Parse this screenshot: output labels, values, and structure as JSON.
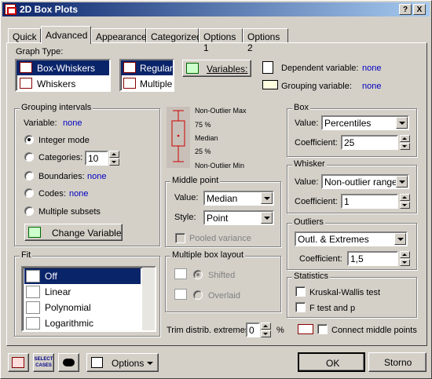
{
  "window": {
    "title": "2D Box Plots",
    "help_btn": "?",
    "close_btn": "X"
  },
  "tabs": [
    "Quick",
    "Advanced",
    "Appearance",
    "Categorized",
    "Options 1",
    "Options 2"
  ],
  "graph_type": {
    "label": "Graph Type:",
    "types_a": [
      "Box-Whiskers",
      "Whiskers"
    ],
    "types_b": [
      "Regular",
      "Multiple"
    ]
  },
  "variables": {
    "button": "Variables:",
    "dependent_label": "Dependent variable:",
    "dependent_value": "none",
    "grouping_label": "Grouping variable:",
    "grouping_value": "none"
  },
  "legend": {
    "max": "Non-Outlier Max",
    "p75": "75 %",
    "median": "Median",
    "p25": "25 %",
    "min": "Non-Outlier Min"
  },
  "grouping": {
    "title": "Grouping intervals",
    "variable_label": "Variable:",
    "variable_value": "none",
    "integer_mode": "Integer mode",
    "categories": "Categories:",
    "categories_value": "10",
    "boundaries": "Boundaries:",
    "boundaries_value": "none",
    "codes": "Codes:",
    "codes_value": "none",
    "multiple_subsets": "Multiple subsets",
    "change_variable": "Change Variable"
  },
  "box": {
    "title": "Box",
    "value_label": "Value:",
    "value": "Percentiles",
    "coef_label": "Coefficient:",
    "coef": "25"
  },
  "whisker": {
    "title": "Whisker",
    "value_label": "Value:",
    "value": "Non-outlier range",
    "coef_label": "Coefficient:",
    "coef": "1"
  },
  "outliers": {
    "title": "Outliers",
    "value": "Outl. & Extremes",
    "coef_label": "Coefficient:",
    "coef": "1,5"
  },
  "middle": {
    "title": "Middle point",
    "value_label": "Value:",
    "value": "Median",
    "style_label": "Style:",
    "style": "Point",
    "pooled": "Pooled variance"
  },
  "fit": {
    "title": "Fit",
    "items": [
      "Off",
      "Linear",
      "Polynomial",
      "Logarithmic"
    ]
  },
  "layout": {
    "title": "Multiple box layout",
    "shifted": "Shifted",
    "overlaid": "Overlaid"
  },
  "trim": {
    "label": "Trim distrib. extremes:",
    "value": "0",
    "unit": "%"
  },
  "statistics": {
    "title": "Statistics",
    "kw": "Kruskal-Wallis test",
    "ft": "F test and p"
  },
  "connect": "Connect middle points",
  "bottom": {
    "select_cases_line1": "SELECT",
    "select_cases_line2": "CASES",
    "options": "Options",
    "ok": "OK",
    "cancel": "Storno"
  }
}
